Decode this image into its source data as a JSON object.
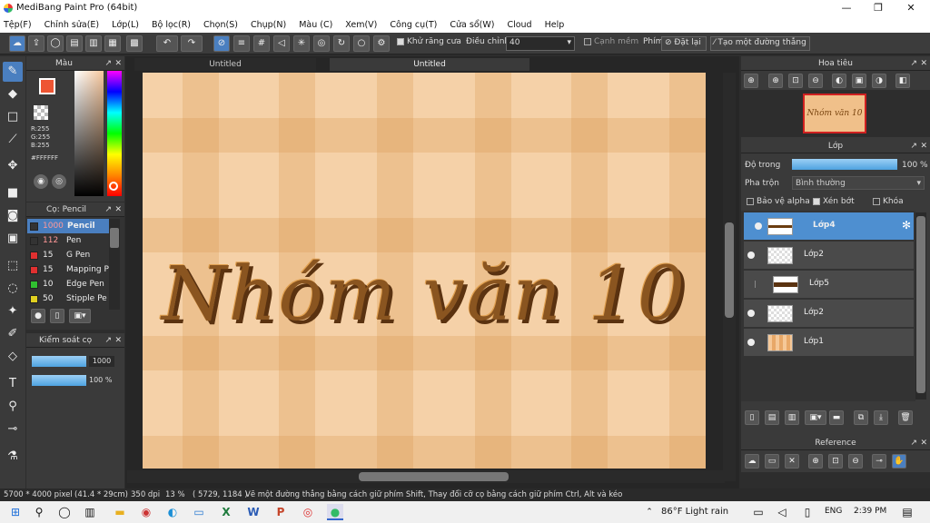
{
  "titlebar": {
    "title": "MediBang Paint Pro (64bit)",
    "minimize": "—",
    "maximize": "❐",
    "close": "✕"
  },
  "menu": [
    "Tệp(F)",
    "Chỉnh sửa(E)",
    "Lớp(L)",
    "Bộ lọc(R)",
    "Chọn(S)",
    "Chụp(N)",
    "Màu (C)",
    "Xem(V)",
    "Công cụ(T)",
    "Cửa sổ(W)",
    "Cloud",
    "Help"
  ],
  "toolbar": {
    "antialias": "Khử răng cưa",
    "adjust_label": "Điều chỉnh",
    "adjust_value": "40",
    "edge": "Cạnh mềm",
    "key_label": "Phím",
    "reset": "Đặt lại",
    "straight_line": "Tạo một đường thẳng"
  },
  "color_panel": {
    "title": "Màu",
    "r": "R:255",
    "g": "G:255",
    "b": "B:255",
    "hex": "#FFFFFF"
  },
  "brush_panel": {
    "title": "Cọ: Pencil",
    "brushes": [
      {
        "size": "1000",
        "name": "Pencil",
        "color": "#333333"
      },
      {
        "size": "112",
        "name": "Pen",
        "color": "#333333"
      },
      {
        "size": "15",
        "name": "G Pen",
        "color": "#e03030"
      },
      {
        "size": "15",
        "name": "Mapping P",
        "color": "#e03030"
      },
      {
        "size": "10",
        "name": "Edge Pen",
        "color": "#30c030"
      },
      {
        "size": "50",
        "name": "Stipple Pe",
        "color": "#e0d020"
      }
    ]
  },
  "brush_control": {
    "title": "Kiểm soát cọ",
    "size_value": "1000",
    "opacity_value": "100 %",
    "size_fraction": 1.0,
    "opacity_fraction": 1.0
  },
  "tabs": [
    "Untitled",
    "Untitled"
  ],
  "artwork_text": "Nhóm văn 10",
  "navigator": {
    "title": "Hoa tiêu",
    "thumb_text": "Nhóm văn 10"
  },
  "layers_panel": {
    "title": "Lớp",
    "opacity_label": "Độ trong",
    "opacity_value": "100 %",
    "opacity_fraction": 1.0,
    "blend_label": "Pha trộn",
    "blend_value": "Bình thường",
    "protect_alpha": "Bảo vệ alpha",
    "clipping": "Xén bớt",
    "lock": "Khóa",
    "layers": [
      {
        "name": "Lớp4",
        "selected": true
      },
      {
        "name": "Lớp2",
        "selected": false
      },
      {
        "name": "Lớp5",
        "selected": false
      },
      {
        "name": "Lớp2",
        "selected": false
      },
      {
        "name": "Lớp1",
        "selected": false
      }
    ]
  },
  "reference": {
    "title": "Reference"
  },
  "status": {
    "size": "5700 * 4000 pixel",
    "cm": "(41.4 * 29cm)",
    "dpi": "350 dpi",
    "zoom": "13 %",
    "coords": "( 5729, 1184 )",
    "hint": "Vẽ một đường thẳng bằng cách giữ phím Shift, Thay đổi cỡ cọ bằng cách giữ phím Ctrl, Alt và kéo"
  },
  "taskbar": {
    "weather": "86°F  Light rain",
    "lang": "ENG",
    "time": "2:39 PM"
  }
}
